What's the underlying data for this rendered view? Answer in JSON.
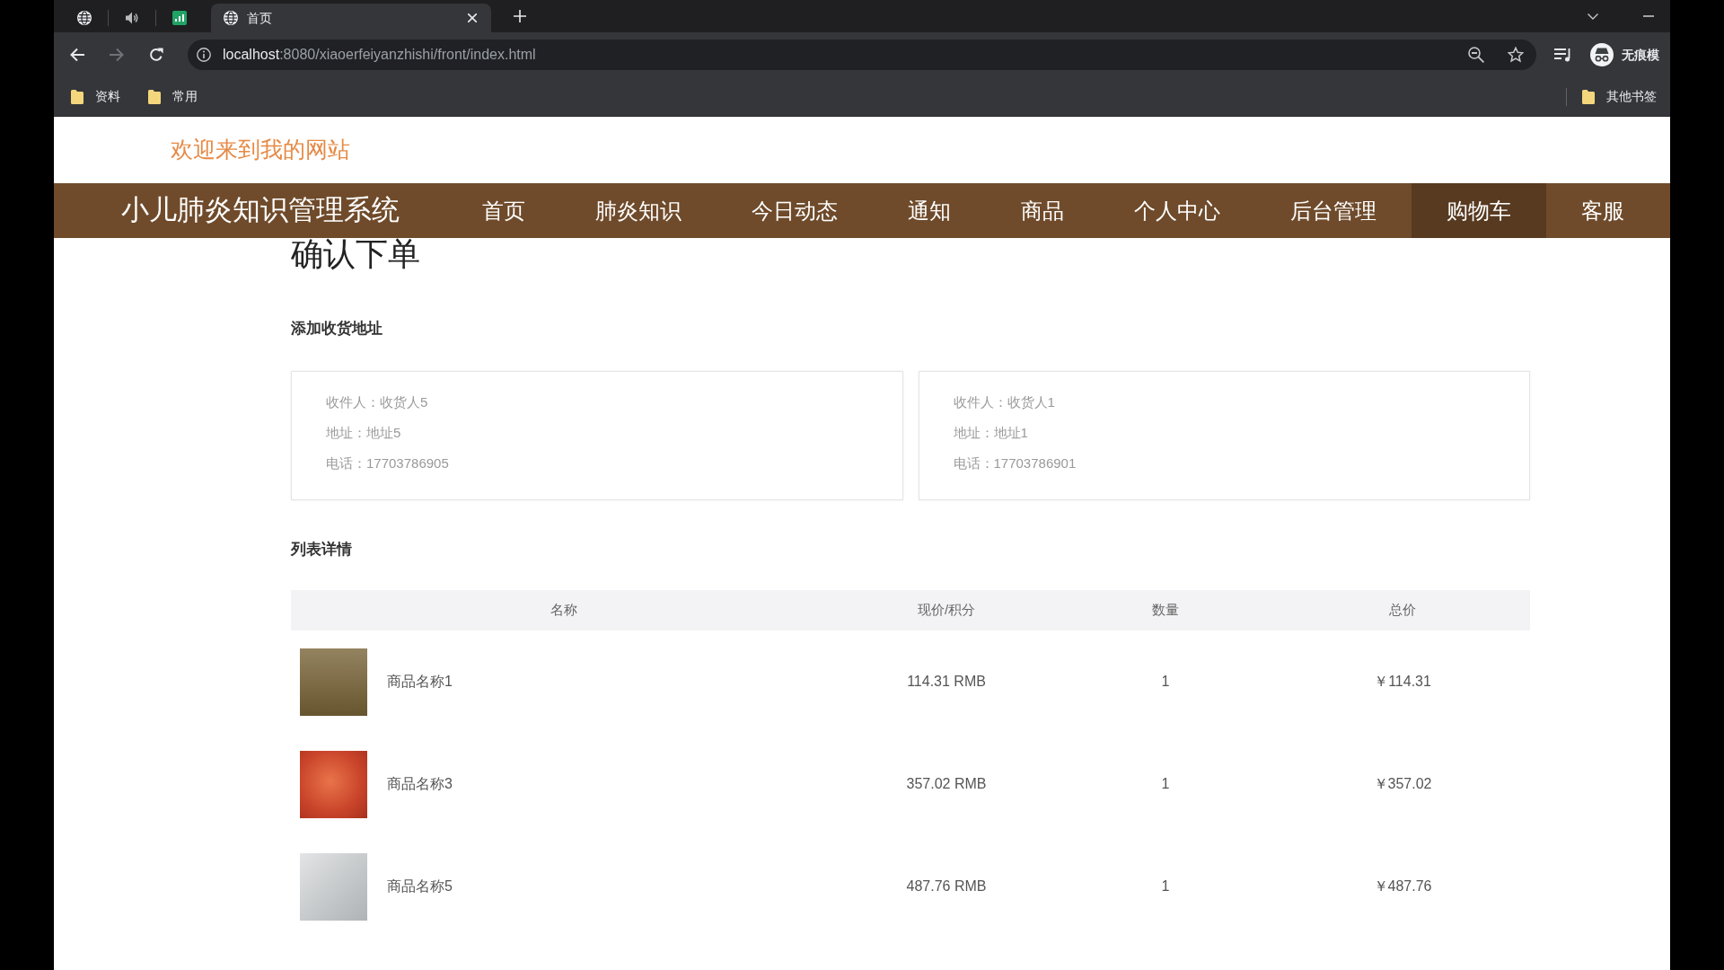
{
  "browser": {
    "tabs": [
      {
        "pinned": true,
        "selected": false
      },
      {
        "pinned": true,
        "selected": false
      },
      {
        "pinned": true,
        "selected": false
      },
      {
        "pinned": false,
        "selected": true,
        "title": "首页"
      }
    ],
    "history_buttons": [
      {
        "kind": "back",
        "disabled": false
      },
      {
        "kind": "forward",
        "disabled": true
      },
      {
        "kind": "reload",
        "disabled": false
      }
    ],
    "url": {
      "host": "localhost",
      "path": ":8080/xiaoerfeiyanzhishi/front/index.html"
    },
    "profile": {
      "label": "无痕模"
    },
    "bookmarks": [
      {
        "label": "资料"
      },
      {
        "label": "常用"
      }
    ],
    "other_bookmarks": "其他书签"
  },
  "site": {
    "welcome": "欢迎来到我的网站",
    "title": "小儿肺炎知识管理系统",
    "nav": [
      {
        "label": "首页",
        "selected": false
      },
      {
        "label": "肺炎知识",
        "selected": false
      },
      {
        "label": "今日动态",
        "selected": false
      },
      {
        "label": "通知",
        "selected": false
      },
      {
        "label": "商品",
        "selected": false
      },
      {
        "label": "个人中心",
        "selected": false
      },
      {
        "label": "后台管理",
        "selected": false
      },
      {
        "label": "购物车",
        "selected": true
      },
      {
        "label": "客服",
        "selected": false
      }
    ]
  },
  "page": {
    "heading": "确认下单",
    "address_section": "添加收货地址",
    "addresses": [
      {
        "recipient": "收件人：收货人5",
        "address": "地址：地址5",
        "phone": "电话：17703786905"
      },
      {
        "recipient": "收件人：收货人1",
        "address": "地址：地址1",
        "phone": "电话：17703786901"
      }
    ],
    "list_section": "列表详情",
    "table": {
      "columns": [
        "名称",
        "现价/积分",
        "数量",
        "总价"
      ],
      "rows": [
        {
          "name": "商品名称1",
          "price": "114.31 RMB",
          "quantity": "1",
          "total": "￥114.31"
        },
        {
          "name": "商品名称3",
          "price": "357.02 RMB",
          "quantity": "1",
          "total": "￥357.02"
        },
        {
          "name": "商品名称5",
          "price": "487.76 RMB",
          "quantity": "1",
          "total": "￥487.76"
        }
      ]
    }
  }
}
